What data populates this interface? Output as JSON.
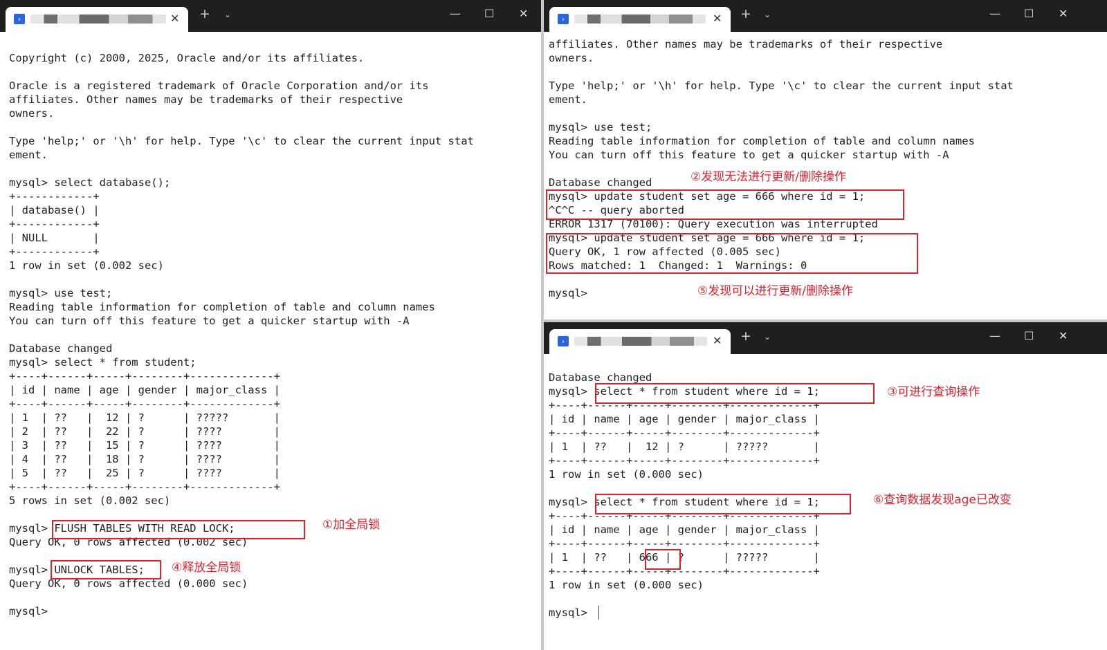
{
  "tabs": {
    "left": {
      "close": "✕",
      "new_tab": "+",
      "dropdown": "⌄"
    },
    "top_right": {
      "close": "✕",
      "new_tab": "+",
      "dropdown": "⌄"
    },
    "bottom_right": {
      "close": "✕",
      "new_tab": "+",
      "dropdown": "⌄"
    }
  },
  "window_controls": {
    "minimize": "—",
    "maximize": "☐",
    "close": "✕"
  },
  "left_terminal": [
    "Copyright (c) 2000, 2025, Oracle and/or its affiliates.",
    "",
    "Oracle is a registered trademark of Oracle Corporation and/or its",
    "affiliates. Other names may be trademarks of their respective",
    "owners.",
    "",
    "Type 'help;' or '\\h' for help. Type '\\c' to clear the current input stat",
    "ement.",
    "",
    "mysql> select database();",
    "+------------+",
    "| database() |",
    "+------------+",
    "| NULL       |",
    "+------------+",
    "1 row in set (0.002 sec)",
    "",
    "mysql> use test;",
    "Reading table information for completion of table and column names",
    "You can turn off this feature to get a quicker startup with -A",
    "",
    "Database changed",
    "mysql> select * from student;",
    "+----+------+-----+--------+-------------+",
    "| id | name | age | gender | major_class |",
    "+----+------+-----+--------+-------------+",
    "| 1  | ??   |  12 | ?      | ?????       |",
    "| 2  | ??   |  22 | ?      | ????        |",
    "| 3  | ??   |  15 | ?      | ????        |",
    "| 4  | ??   |  18 | ?      | ????        |",
    "| 5  | ??   |  25 | ?      | ????        |",
    "+----+------+-----+--------+-------------+",
    "5 rows in set (0.002 sec)",
    "",
    "mysql> FLUSH TABLES WITH READ LOCK;",
    "Query OK, 0 rows affected (0.002 sec)",
    "",
    "mysql> UNLOCK TABLES;",
    "Query OK, 0 rows affected (0.000 sec)",
    "",
    "mysql>"
  ],
  "top_right_terminal": [
    "affiliates. Other names may be trademarks of their respective",
    "owners.",
    "",
    "Type 'help;' or '\\h' for help. Type '\\c' to clear the current input stat",
    "ement.",
    "",
    "mysql> use test;",
    "Reading table information for completion of table and column names",
    "You can turn off this feature to get a quicker startup with -A",
    "",
    "Database changed",
    "mysql> update student set age = 666 where id = 1;",
    "^C^C -- query aborted",
    "ERROR 1317 (70100): Query execution was interrupted",
    "mysql> update student set age = 666 where id = 1;",
    "Query OK, 1 row affected (0.005 sec)",
    "Rows matched: 1  Changed: 1  Warnings: 0",
    "",
    "mysql>"
  ],
  "bottom_right_terminal": [
    "Database changed",
    "mysql> select * from student where id = 1;",
    "+----+------+-----+--------+-------------+",
    "| id | name | age | gender | major_class |",
    "+----+------+-----+--------+-------------+",
    "| 1  | ??   |  12 | ?      | ?????       |",
    "+----+------+-----+--------+-------------+",
    "1 row in set (0.000 sec)",
    "",
    "mysql> select * from student where id = 1;",
    "+----+------+-----+--------+-------------+",
    "| id | name | age | gender | major_class |",
    "+----+------+-----+--------+-------------+",
    "| 1  | ??   | 666 | ?      | ?????       |",
    "+----+------+-----+--------+-------------+",
    "1 row in set (0.000 sec)",
    "",
    "mysql>"
  ],
  "annotations": {
    "add_global_lock": "①加全局锁",
    "cannot_update": "②发现无法进行更新/删除操作",
    "can_query": "③可进行查询操作",
    "release_global_lock": "④释放全局锁",
    "can_update": "⑤发现可以进行更新/删除操作",
    "age_changed": "⑥查询数据发现age已改变"
  },
  "colors": {
    "annotation": "#e0202a",
    "titlebar": "#1f1f1f",
    "terminal_bg": "#ffffff",
    "text": "#222222"
  }
}
